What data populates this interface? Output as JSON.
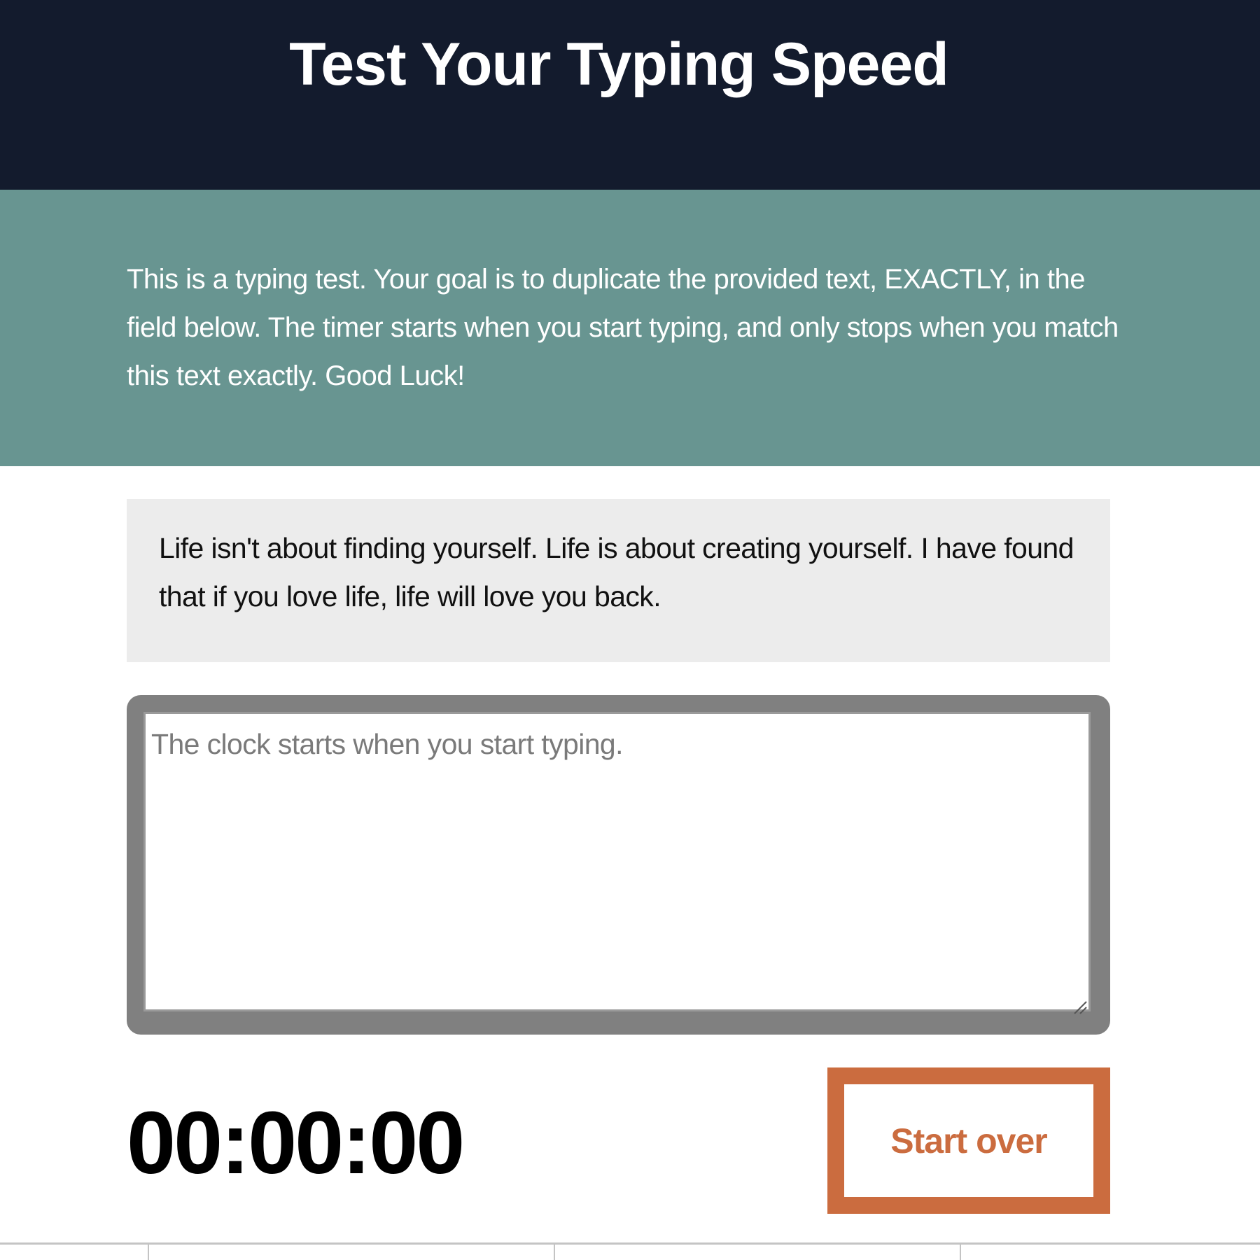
{
  "header": {
    "title": "Test Your Typing Speed"
  },
  "intro": {
    "text": "This is a typing test. Your goal is to duplicate the provided text, EXACTLY, in the field below. The timer starts when you start typing, and only stops when you match this text exactly. Good Luck!"
  },
  "sample": {
    "text": "Life isn't about finding yourself. Life is about creating yourself. I have found that if you love life, life will love you back."
  },
  "input": {
    "value": "",
    "placeholder": "The clock starts when you start typing."
  },
  "timer": {
    "value": "00:00:00"
  },
  "controls": {
    "start_over_label": "Start over"
  },
  "colors": {
    "header_bg": "#131b2d",
    "intro_bg": "#689591",
    "sample_bg": "#ececec",
    "input_border": "#808080",
    "accent": "#cb6c3f"
  }
}
